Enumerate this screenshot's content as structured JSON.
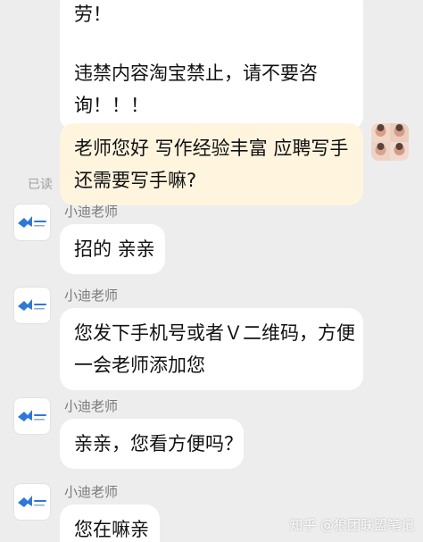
{
  "colors": {
    "background": "#ededed",
    "incoming_bubble": "#ffffff",
    "outgoing_bubble": "#fff5df",
    "message_text": "#111111",
    "name_text": "#7a7a7a",
    "read_text": "#a0a0a0",
    "logo_blue": "#2f78d4"
  },
  "messages": {
    "top_warning": {
      "line1": "劳！",
      "line2": "违禁内容淘宝禁止，请不要咨",
      "line3": "询！！！"
    },
    "self_msg": {
      "line1": "老师您好 写作经验丰富 应聘写手",
      "line2": "还需要写手嘛?"
    },
    "read_status": "已读",
    "teacher_1": {
      "name": "小迪老师",
      "line1": "招的 亲亲"
    },
    "teacher_2": {
      "name": "小迪老师",
      "line1": "您发下手机号或者Ｖ二维码，方便",
      "line2": "一会老师添加您"
    },
    "teacher_3": {
      "name": "小迪老师",
      "line1": "亲亲，您看方便吗？"
    },
    "teacher_4": {
      "name": "小迪老师",
      "line1": "您在嘛亲"
    }
  },
  "avatar": {
    "teacher_icon": "brand-logo-icon",
    "self_icon": "photo-avatar-icon"
  },
  "watermark": "知乎 @狼团联盟笔记"
}
